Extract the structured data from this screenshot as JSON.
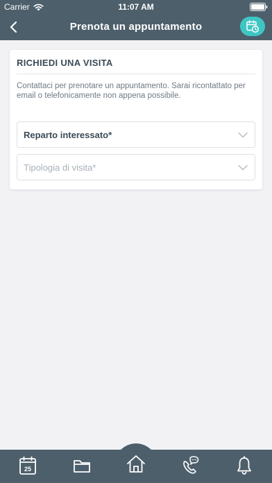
{
  "status_bar": {
    "carrier": "Carrier",
    "time": "11:07 AM"
  },
  "nav": {
    "title": "Prenota un appuntamento",
    "left_icon": "chevron-left-icon",
    "right_icon": "calendar-clock-icon"
  },
  "card": {
    "title": "RICHIEDI UNA VISITA",
    "description": "Contattaci per prenotare un appuntamento. Sarai ricontattato per email o telefonicamente non appena possibile.",
    "fields": [
      {
        "label": "Reparto interessato*"
      },
      {
        "label": "Tipologia di visita*"
      }
    ]
  },
  "tabbar": {
    "calendar_day": "25",
    "tabs": [
      "calendar-icon",
      "folder-icon",
      "home-icon",
      "phone-chat-icon",
      "bell-icon"
    ]
  },
  "colors": {
    "header": "#4d5f6b",
    "accent": "#3ec6c3",
    "background": "#f2f2f5",
    "text_dark": "#3b4a55",
    "text_muted": "#6e7a84",
    "placeholder": "#a9b0b7"
  }
}
